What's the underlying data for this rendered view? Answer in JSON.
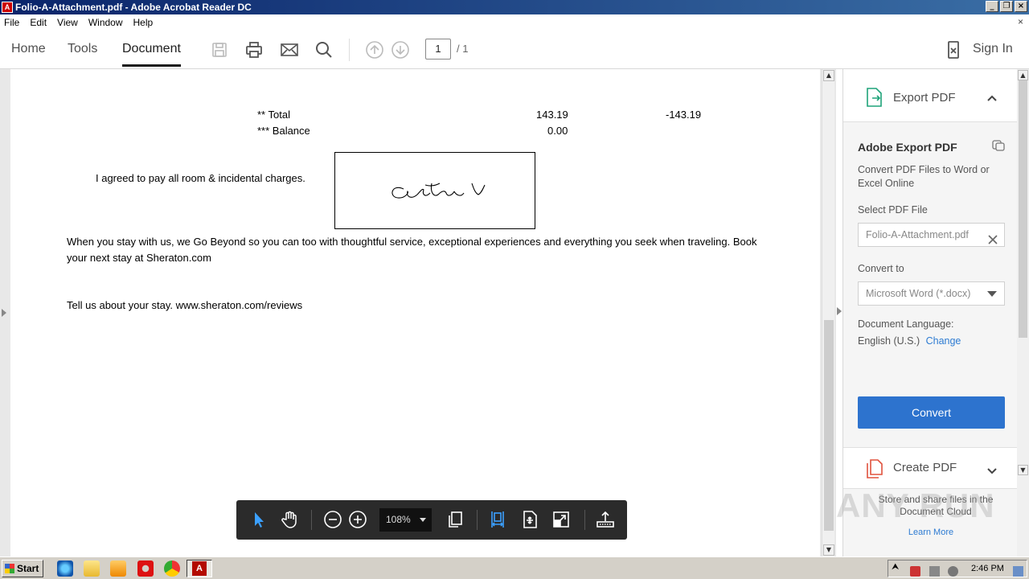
{
  "window": {
    "title": "Folio-A-Attachment.pdf - Adobe Acrobat Reader DC",
    "buttons": [
      "minimize",
      "restore",
      "close"
    ]
  },
  "menubar": {
    "items": [
      "File",
      "Edit",
      "View",
      "Window",
      "Help"
    ],
    "close_glyph": "×"
  },
  "toolbar": {
    "tabs": [
      "Home",
      "Tools",
      "Document"
    ],
    "active_tab": "Document",
    "page_current": "1",
    "page_total": "/ 1",
    "signin": "Sign In",
    "icons": [
      "save-icon",
      "print-icon",
      "email-icon",
      "search-icon",
      "prev-page-icon",
      "next-page-icon",
      "mobile-icon"
    ]
  },
  "document": {
    "total_label": "** Total",
    "total_debit": "143.19",
    "total_credit": "-143.19",
    "balance_label": "*** Balance",
    "balance_value": "0.00",
    "agreement": "I agreed to pay all room & incidental charges.",
    "promo_line1": "When you stay with us, we Go Beyond so you can too with thoughtful service, exceptional experiences and everything you seek when traveling. Book",
    "promo_line2": "your next stay at Sheraton.com",
    "feedback": "Tell us about your stay. www.sheraton.com/reviews"
  },
  "float_toolbar": {
    "zoom": "108%",
    "icons": [
      "select-cursor-icon",
      "hand-tool-icon",
      "zoom-out-icon",
      "zoom-in-icon",
      "page-display-icon",
      "fit-width-icon",
      "fit-page-icon",
      "fullscreen-icon",
      "share-icon"
    ]
  },
  "right_panel": {
    "export_header": "Export PDF",
    "title": "Adobe Export PDF",
    "description": "Convert PDF Files to Word or Excel Online",
    "select_file_link": "Select PDF File",
    "file_name": "Folio-A-Attachment.pdf",
    "convert_to_label": "Convert to",
    "convert_to_value": "Microsoft Word (*.docx)",
    "language_label": "Document Language:",
    "language_value": "English (U.S.)",
    "change_link": "Change",
    "convert_button": "Convert",
    "create_header": "Create PDF",
    "footer_text": "Store and share files in the Document Cloud",
    "learn_more": "Learn More"
  },
  "watermark": "ANY RUN",
  "taskbar": {
    "start": "Start",
    "clock": "2:46 PM",
    "apps": [
      "ie-icon",
      "folder-icon",
      "media-player-icon",
      "opera-icon",
      "chrome-icon",
      "acrobat-icon"
    ]
  },
  "colors": {
    "accent": "#2d73ce",
    "link": "#2d7bd2",
    "titlebar": "#0a246a"
  }
}
